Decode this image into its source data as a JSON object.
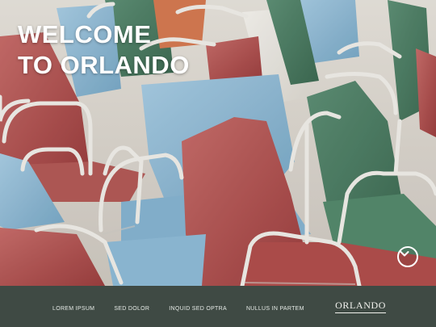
{
  "hero": {
    "headline_line1": "WELCOME",
    "headline_line2": "TO ORLANDO",
    "scroll_button_icon": "chevron-down-icon"
  },
  "footer": {
    "nav": [
      {
        "label": "LOREM IPSUM"
      },
      {
        "label": "SED DOLOR"
      },
      {
        "label": "INQUID SED OPTRA"
      },
      {
        "label": "NULLUS IN PARTEM"
      }
    ],
    "brand": "ORLANDO"
  },
  "colors": {
    "footer_bg": "#3f4a44",
    "chair_red": "#b9514f",
    "chair_blue": "#8fbcd8",
    "chair_green": "#4e7e63",
    "chair_white": "#f0eeea"
  }
}
